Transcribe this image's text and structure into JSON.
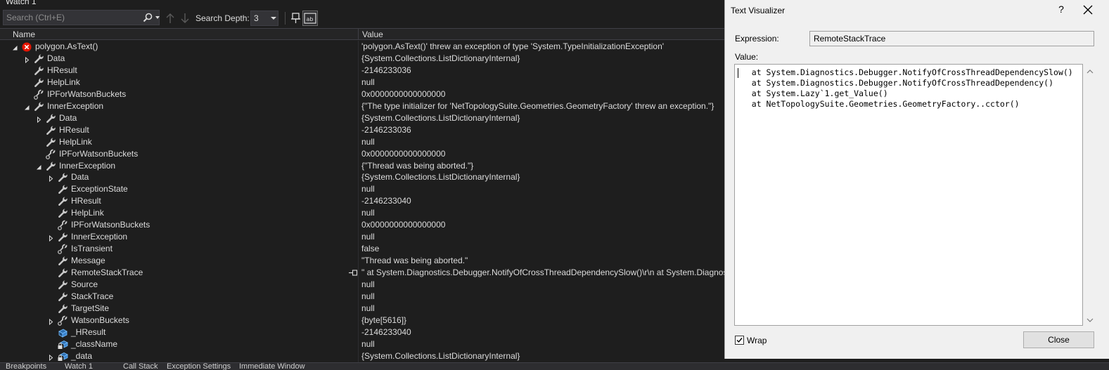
{
  "watch": {
    "title": "Watch 1",
    "search": {
      "placeholder": "Search (Ctrl+E)"
    },
    "search_depth_label": "Search Depth:",
    "search_depth_value": "3",
    "columns": {
      "name": "Name",
      "value": "Value"
    },
    "rows": [
      {
        "name": "polygon.AsText()",
        "value": "'polygon.AsText()' threw an exception of type 'System.TypeInitializationException'",
        "depth": 0,
        "expander": "expanded",
        "icon": "error-icon"
      },
      {
        "name": "Data",
        "value": "{System.Collections.ListDictionaryInternal}",
        "depth": 1,
        "expander": "collapsed",
        "icon": "wrench-icon"
      },
      {
        "name": "HResult",
        "value": "-2146233036",
        "depth": 1,
        "expander": "none",
        "icon": "wrench-icon"
      },
      {
        "name": "HelpLink",
        "value": "null",
        "depth": 1,
        "expander": "none",
        "icon": "wrench-icon"
      },
      {
        "name": "IPForWatsonBuckets",
        "value": "0x0000000000000000",
        "depth": 1,
        "expander": "none",
        "icon": "wrench-link-icon"
      },
      {
        "name": "InnerException",
        "value": "{\"The type initializer for 'NetTopologySuite.Geometries.GeometryFactory' threw an exception.\"}",
        "depth": 1,
        "expander": "expanded",
        "icon": "wrench-icon"
      },
      {
        "name": "Data",
        "value": "{System.Collections.ListDictionaryInternal}",
        "depth": 2,
        "expander": "collapsed",
        "icon": "wrench-icon"
      },
      {
        "name": "HResult",
        "value": "-2146233036",
        "depth": 2,
        "expander": "none",
        "icon": "wrench-icon"
      },
      {
        "name": "HelpLink",
        "value": "null",
        "depth": 2,
        "expander": "none",
        "icon": "wrench-icon"
      },
      {
        "name": "IPForWatsonBuckets",
        "value": "0x0000000000000000",
        "depth": 2,
        "expander": "none",
        "icon": "wrench-link-icon"
      },
      {
        "name": "InnerException",
        "value": "{\"Thread was being aborted.\"}",
        "depth": 2,
        "expander": "expanded",
        "icon": "wrench-icon"
      },
      {
        "name": "Data",
        "value": "{System.Collections.ListDictionaryInternal}",
        "depth": 3,
        "expander": "collapsed",
        "icon": "wrench-icon"
      },
      {
        "name": "ExceptionState",
        "value": "null",
        "depth": 3,
        "expander": "none",
        "icon": "wrench-icon"
      },
      {
        "name": "HResult",
        "value": "-2146233040",
        "depth": 3,
        "expander": "none",
        "icon": "wrench-icon"
      },
      {
        "name": "HelpLink",
        "value": "null",
        "depth": 3,
        "expander": "none",
        "icon": "wrench-icon"
      },
      {
        "name": "IPForWatsonBuckets",
        "value": "0x0000000000000000",
        "depth": 3,
        "expander": "none",
        "icon": "wrench-link-icon"
      },
      {
        "name": "InnerException",
        "value": "null",
        "depth": 3,
        "expander": "collapsed",
        "icon": "wrench-icon"
      },
      {
        "name": "IsTransient",
        "value": "false",
        "depth": 3,
        "expander": "none",
        "icon": "wrench-link-icon"
      },
      {
        "name": "Message",
        "value": "\"Thread was being aborted.\"",
        "depth": 3,
        "expander": "none",
        "icon": "wrench-icon"
      },
      {
        "name": "RemoteStackTrace",
        "value": "\"   at System.Diagnostics.Debugger.NotifyOfCrossThreadDependencySlow()\\r\\n   at System.Diagnostics.Debugger.NotifyOfCrossThreadDependency()",
        "depth": 3,
        "expander": "none",
        "icon": "wrench-icon",
        "visualizer": true
      },
      {
        "name": "Source",
        "value": "null",
        "depth": 3,
        "expander": "none",
        "icon": "wrench-icon"
      },
      {
        "name": "StackTrace",
        "value": "null",
        "depth": 3,
        "expander": "none",
        "icon": "wrench-icon"
      },
      {
        "name": "TargetSite",
        "value": "null",
        "depth": 3,
        "expander": "none",
        "icon": "wrench-icon"
      },
      {
        "name": "WatsonBuckets",
        "value": "{byte[5616]}",
        "depth": 3,
        "expander": "collapsed",
        "icon": "wrench-link-icon"
      },
      {
        "name": "_HResult",
        "value": "-2146233040",
        "depth": 3,
        "expander": "none",
        "icon": "field-icon"
      },
      {
        "name": "_className",
        "value": "null",
        "depth": 3,
        "expander": "none",
        "icon": "field-lock-icon"
      },
      {
        "name": "_data",
        "value": "{System.Collections.ListDictionaryInternal}",
        "depth": 3,
        "expander": "collapsed",
        "icon": "field-lock-icon"
      }
    ],
    "bottom_tabs": [
      "Breakpoints",
      "Watch 1",
      "Call Stack",
      "Exception Settings",
      "Immediate Window"
    ]
  },
  "dialog": {
    "title": "Text Visualizer",
    "help": "?",
    "expression_label": "Expression:",
    "expression_value": "RemoteStackTrace",
    "value_label": "Value:",
    "value_text": "   at System.Diagnostics.Debugger.NotifyOfCrossThreadDependencySlow()\n   at System.Diagnostics.Debugger.NotifyOfCrossThreadDependency()\n   at System.Lazy`1.get_Value()\n   at NetTopologySuite.Geometries.GeometryFactory..cctor()",
    "wrap_label": "Wrap",
    "wrap_checked": true,
    "close_label": "Close"
  },
  "colors": {
    "background": "#1e1e1e",
    "error_red": "#e51400",
    "wrench": "#c8c8c8",
    "field_blue": "#75beff",
    "dialog_bg": "#f0f0f0"
  }
}
